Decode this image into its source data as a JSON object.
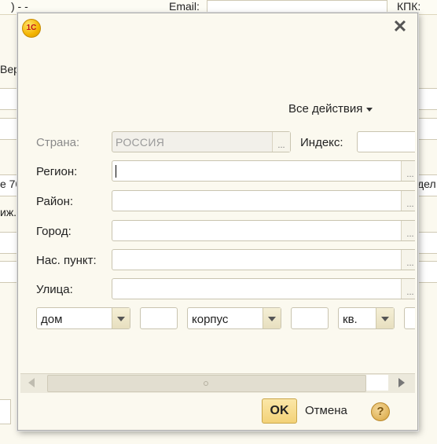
{
  "background": {
    "top_left_text": ")    -  -",
    "email_label": "Email:",
    "kpp_label": "КПК:",
    "left_fragment_1": "Вер",
    "left_fragment_2": "е 70",
    "left_fragment_3": "иж.",
    "right_fragment": "дел"
  },
  "window": {
    "logo_text": "1С",
    "close_symbol": "✕"
  },
  "toolbar": {
    "all_actions_label": "Все действия"
  },
  "form": {
    "country": {
      "label": "Страна:",
      "value": "РОССИЯ"
    },
    "index": {
      "label": "Индекс:",
      "value": ""
    },
    "region": {
      "label": "Регион:",
      "value": ""
    },
    "district": {
      "label": "Район:",
      "value": ""
    },
    "city": {
      "label": "Город:",
      "value": ""
    },
    "settlement": {
      "label": "Нас. пункт:",
      "value": ""
    },
    "street": {
      "label": "Улица:",
      "value": ""
    },
    "house_type": {
      "selected": "дом"
    },
    "house_number": {
      "value": ""
    },
    "building_type": {
      "selected": "корпус"
    },
    "building_number": {
      "value": ""
    },
    "apartment_type": {
      "selected": "кв."
    },
    "apartment_number": {
      "value": ""
    },
    "choose_dots": "..."
  },
  "footer": {
    "ok_label": "OK",
    "cancel_label": "Отмена",
    "help_symbol": "?"
  }
}
